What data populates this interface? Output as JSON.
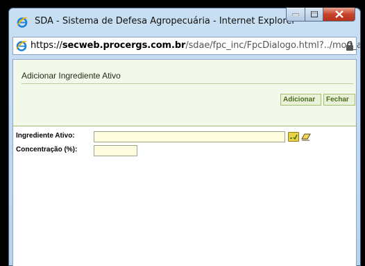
{
  "window": {
    "title": "SDA - Sistema de Defesa Agropecuária - Internet Explorer",
    "address_scheme": "https://",
    "address_host": "secweb.procergs.com.br",
    "address_path": "/sdae/fpc_inc/FpcDialogo.html?../mod_ag"
  },
  "dialog": {
    "title": "Adicionar Ingrediente Ativo",
    "buttons": {
      "add_label": "Adicionar",
      "close_label": "Fechar"
    }
  },
  "form": {
    "ingrediente_label": "Ingrediente Ativo:",
    "ingrediente_value": "",
    "concentracao_label": "Concentração (%):",
    "concentracao_value": ""
  },
  "icons": {
    "browser": "ie-logo-icon",
    "lock": "lock-icon",
    "search": "search-icon",
    "clear": "eraser-icon"
  },
  "colors": {
    "panel_bg": "#f3f8ea",
    "button_text": "#4c6a1f",
    "field_bg": "#fffce0",
    "close_button": "#c7432b"
  }
}
